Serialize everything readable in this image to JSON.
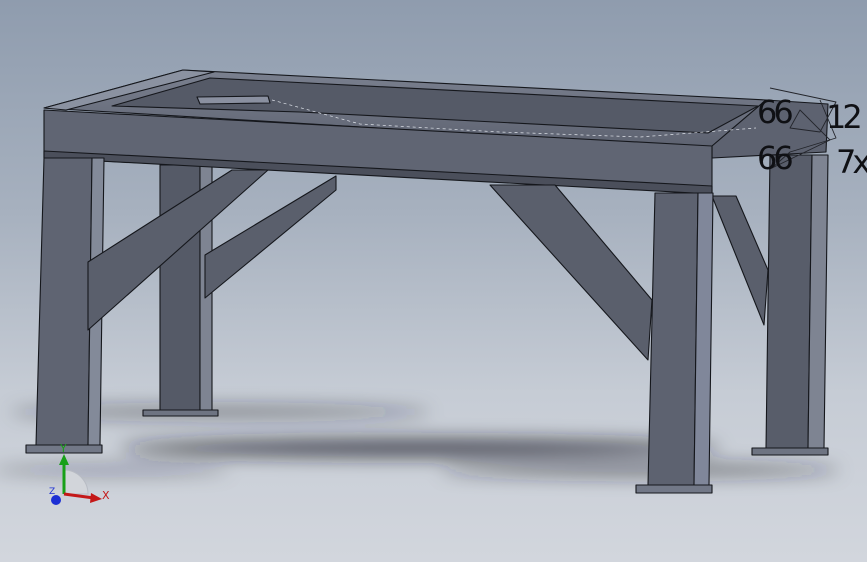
{
  "weld_annotations": {
    "upper_left": "66",
    "upper_right": "12",
    "lower_left": "66",
    "lower_right": "7x"
  },
  "triad": {
    "x_label": "X",
    "y_label": "Y",
    "z_label": "Z",
    "colors": {
      "x": "#c41818",
      "y": "#18a018",
      "z": "#1c2fd4"
    }
  },
  "colors": {
    "steel": "#5d6270",
    "background_top": "#8f9cae",
    "background_bottom": "#d2d6dd"
  }
}
